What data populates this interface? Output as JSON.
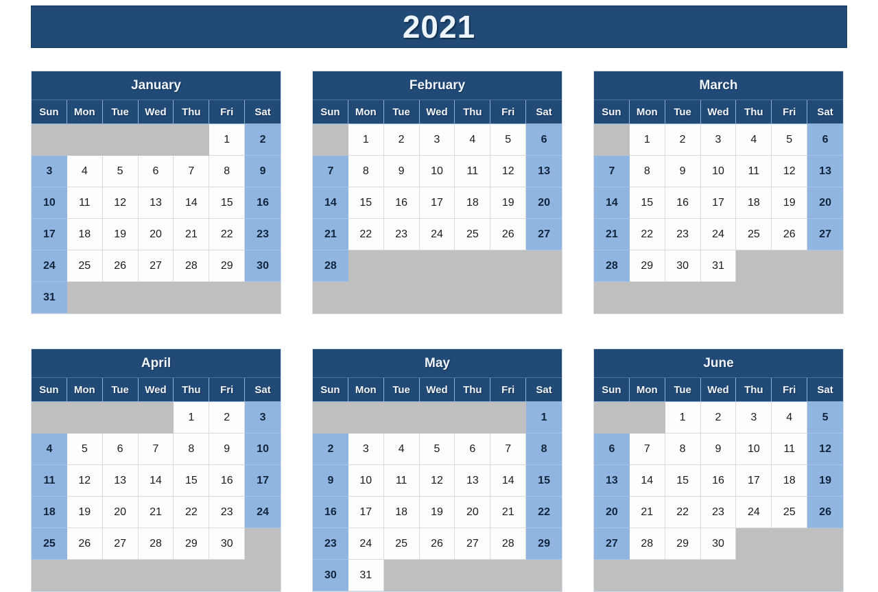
{
  "title": "2021",
  "colors": {
    "header_blue": "#214a77",
    "weekend_blue": "#8fb5e0",
    "empty_gray": "#bfbfbf",
    "weekday_white": "#fdfdfd",
    "title_text": "#eef4fb"
  },
  "day_names": [
    "Sun",
    "Mon",
    "Tue",
    "Wed",
    "Thu",
    "Fri",
    "Sat"
  ],
  "months": [
    {
      "name": "January",
      "first_weekday": 5,
      "days": 31,
      "weeks": [
        [
          "",
          "",
          "",
          "",
          "",
          "1",
          "2"
        ],
        [
          "3",
          "4",
          "5",
          "6",
          "7",
          "8",
          "9"
        ],
        [
          "10",
          "11",
          "12",
          "13",
          "14",
          "15",
          "16"
        ],
        [
          "17",
          "18",
          "19",
          "20",
          "21",
          "22",
          "23"
        ],
        [
          "24",
          "25",
          "26",
          "27",
          "28",
          "29",
          "30"
        ],
        [
          "31",
          "",
          "",
          "",
          "",
          "",
          ""
        ]
      ]
    },
    {
      "name": "February",
      "first_weekday": 1,
      "days": 28,
      "weeks": [
        [
          "",
          "1",
          "2",
          "3",
          "4",
          "5",
          "6"
        ],
        [
          "7",
          "8",
          "9",
          "10",
          "11",
          "12",
          "13"
        ],
        [
          "14",
          "15",
          "16",
          "17",
          "18",
          "19",
          "20"
        ],
        [
          "21",
          "22",
          "23",
          "24",
          "25",
          "26",
          "27"
        ],
        [
          "28",
          "",
          "",
          "",
          "",
          "",
          ""
        ],
        [
          "",
          "",
          "",
          "",
          "",
          "",
          ""
        ]
      ]
    },
    {
      "name": "March",
      "first_weekday": 1,
      "days": 31,
      "weeks": [
        [
          "",
          "1",
          "2",
          "3",
          "4",
          "5",
          "6"
        ],
        [
          "7",
          "8",
          "9",
          "10",
          "11",
          "12",
          "13"
        ],
        [
          "14",
          "15",
          "16",
          "17",
          "18",
          "19",
          "20"
        ],
        [
          "21",
          "22",
          "23",
          "24",
          "25",
          "26",
          "27"
        ],
        [
          "28",
          "29",
          "30",
          "31",
          "",
          "",
          ""
        ],
        [
          "",
          "",
          "",
          "",
          "",
          "",
          ""
        ]
      ]
    },
    {
      "name": "April",
      "first_weekday": 4,
      "days": 30,
      "weeks": [
        [
          "",
          "",
          "",
          "",
          "1",
          "2",
          "3"
        ],
        [
          "4",
          "5",
          "6",
          "7",
          "8",
          "9",
          "10"
        ],
        [
          "11",
          "12",
          "13",
          "14",
          "15",
          "16",
          "17"
        ],
        [
          "18",
          "19",
          "20",
          "21",
          "22",
          "23",
          "24"
        ],
        [
          "25",
          "26",
          "27",
          "28",
          "29",
          "30",
          ""
        ],
        [
          "",
          "",
          "",
          "",
          "",
          "",
          ""
        ]
      ]
    },
    {
      "name": "May",
      "first_weekday": 6,
      "days": 31,
      "weeks": [
        [
          "",
          "",
          "",
          "",
          "",
          "",
          "1"
        ],
        [
          "2",
          "3",
          "4",
          "5",
          "6",
          "7",
          "8"
        ],
        [
          "9",
          "10",
          "11",
          "12",
          "13",
          "14",
          "15"
        ],
        [
          "16",
          "17",
          "18",
          "19",
          "20",
          "21",
          "22"
        ],
        [
          "23",
          "24",
          "25",
          "26",
          "27",
          "28",
          "29"
        ],
        [
          "30",
          "31",
          "",
          "",
          "",
          "",
          ""
        ]
      ]
    },
    {
      "name": "June",
      "first_weekday": 2,
      "days": 30,
      "weeks": [
        [
          "",
          "",
          "1",
          "2",
          "3",
          "4",
          "5"
        ],
        [
          "6",
          "7",
          "8",
          "9",
          "10",
          "11",
          "12"
        ],
        [
          "13",
          "14",
          "15",
          "16",
          "17",
          "18",
          "19"
        ],
        [
          "20",
          "21",
          "22",
          "23",
          "24",
          "25",
          "26"
        ],
        [
          "27",
          "28",
          "29",
          "30",
          "",
          "",
          ""
        ],
        [
          "",
          "",
          "",
          "",
          "",
          "",
          ""
        ]
      ]
    }
  ]
}
